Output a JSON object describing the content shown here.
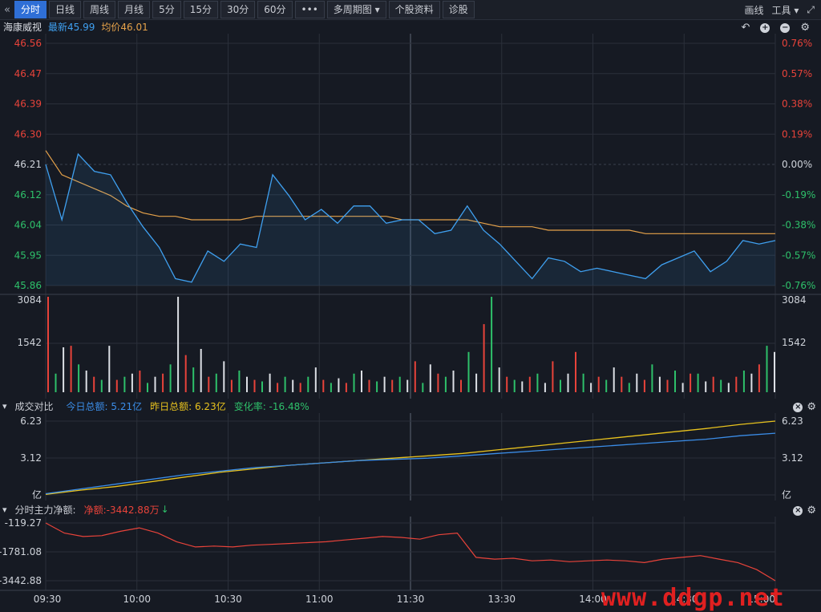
{
  "toolbar": {
    "back_icon": "double-chevron-left-icon",
    "tabs": [
      "分时",
      "日线",
      "周线",
      "月线",
      "5分",
      "15分",
      "30分",
      "60分",
      "•••",
      "多周期图",
      "个股资料",
      "诊股"
    ],
    "more_periods_arrow": "▾",
    "right": {
      "draw_label": "画线",
      "tools_label": "工具",
      "expand_icon": "fullscreen-icon"
    }
  },
  "legend": {
    "stock_name": "海康威视",
    "latest_label": "最新45.99",
    "avg_label": "均价46.01"
  },
  "price_axis": {
    "left": [
      "46.56",
      "46.47",
      "46.39",
      "46.30",
      "46.21",
      "46.12",
      "46.04",
      "45.95",
      "45.86"
    ],
    "right": [
      "0.76%",
      "0.57%",
      "0.38%",
      "0.19%",
      "0.00%",
      "-0.19%",
      "-0.38%",
      "-0.57%",
      "-0.76%"
    ]
  },
  "volume_axis": {
    "left": [
      "3084",
      "1542"
    ],
    "right": [
      "3084",
      "1542"
    ]
  },
  "turnover": {
    "title": "成交对比",
    "today_label": "今日总额: 5.21亿",
    "yesterday_label": "昨日总额: 6.23亿",
    "change_label": "变化率: -16.48%",
    "axis_left": [
      "6.23",
      "3.12",
      "亿"
    ],
    "axis_right": [
      "6.23",
      "3.12",
      "亿"
    ]
  },
  "netflow": {
    "title": "分时主力净额:",
    "net_label": "净额:-3442.88万",
    "down_arrow": "↓",
    "axis_left": [
      "-119.27",
      "-1781.08",
      "-3442.88"
    ]
  },
  "time_axis": [
    "09:30",
    "10:00",
    "10:30",
    "11:00",
    "11:30",
    "13:30",
    "14:00",
    "14:30",
    "15:00"
  ],
  "watermark": "www.ddgp.net",
  "colors": {
    "up": "#e8433a",
    "down": "#2ec06a",
    "price_line": "#3fa0f0",
    "avg_line": "#e6a24a",
    "today_turnover": "#3b8de8",
    "yesterday_turnover": "#e8c21e",
    "netflow_line": "#e8433a"
  },
  "chart_data": [
    {
      "type": "line",
      "title": "",
      "ylim": [
        45.86,
        46.56
      ],
      "x": [
        "09:30",
        "10:00",
        "10:30",
        "11:00",
        "11:30",
        "13:30",
        "14:00",
        "14:30",
        "15:00"
      ],
      "series": [
        {
          "name": "最新",
          "values": [
            46.21,
            46.05,
            46.24,
            46.19,
            46.18,
            46.1,
            46.03,
            45.97,
            45.88,
            45.87,
            45.96,
            45.93,
            45.98,
            45.97,
            46.18,
            46.12,
            46.05,
            46.08,
            46.04,
            46.09,
            46.09,
            46.04,
            46.05,
            46.05,
            46.01,
            46.02,
            46.09,
            46.02,
            45.98,
            45.93,
            45.88,
            45.94,
            45.93,
            45.9,
            45.91,
            45.9,
            45.89,
            45.88,
            45.92,
            45.94,
            45.96,
            45.9,
            45.93,
            45.99,
            45.98,
            45.99
          ]
        },
        {
          "name": "均价",
          "values": [
            46.25,
            46.18,
            46.16,
            46.14,
            46.12,
            46.09,
            46.07,
            46.06,
            46.06,
            46.05,
            46.05,
            46.05,
            46.05,
            46.06,
            46.06,
            46.06,
            46.06,
            46.06,
            46.06,
            46.06,
            46.06,
            46.06,
            46.05,
            46.05,
            46.05,
            46.05,
            46.05,
            46.04,
            46.03,
            46.03,
            46.03,
            46.02,
            46.02,
            46.02,
            46.02,
            46.02,
            46.02,
            46.01,
            46.01,
            46.01,
            46.01,
            46.01,
            46.01,
            46.01,
            46.01,
            46.01
          ]
        }
      ]
    },
    {
      "type": "bar",
      "title": "",
      "ylim": [
        0,
        3084
      ],
      "values": [
        3084,
        600,
        1450,
        1500,
        900,
        700,
        500,
        400,
        1500,
        400,
        500,
        600,
        700,
        300,
        500,
        600,
        900,
        3084,
        1200,
        800,
        1400,
        500,
        600,
        1000,
        400,
        700,
        500,
        400,
        350,
        600,
        300,
        500,
        400,
        300,
        500,
        800,
        400,
        300,
        450,
        300,
        600,
        700,
        400,
        350,
        500,
        400,
        500,
        400,
        1000,
        300,
        900,
        600,
        500,
        700,
        400,
        1300,
        600,
        2200,
        3084,
        800,
        500,
        400,
        350,
        500,
        600,
        300,
        1000,
        400,
        600,
        1300,
        600,
        300,
        500,
        400,
        800,
        500,
        300,
        600,
        400,
        900,
        500,
        400,
        700,
        300,
        600,
        600,
        350,
        500,
        400,
        300,
        500,
        700,
        600,
        900,
        1500,
        1300
      ]
    },
    {
      "type": "line",
      "title": "",
      "ylim": [
        0,
        6.23
      ],
      "series": [
        {
          "name": "今日总额",
          "values": [
            0.1,
            0.5,
            0.9,
            1.3,
            1.7,
            2.0,
            2.3,
            2.5,
            2.7,
            2.9,
            3.0,
            3.1,
            3.3,
            3.5,
            3.7,
            3.9,
            4.1,
            4.3,
            4.5,
            4.7,
            5.0,
            5.21
          ]
        },
        {
          "name": "昨日总额",
          "values": [
            0.05,
            0.4,
            0.7,
            1.1,
            1.5,
            1.9,
            2.2,
            2.5,
            2.7,
            2.9,
            3.1,
            3.3,
            3.5,
            3.8,
            4.1,
            4.4,
            4.7,
            5.0,
            5.3,
            5.6,
            5.95,
            6.23
          ]
        }
      ]
    },
    {
      "type": "line",
      "title": "",
      "ylim": [
        -3442.88,
        -119.27
      ],
      "series": [
        {
          "name": "净额",
          "values": [
            -119.27,
            -700,
            -900,
            -850,
            -600,
            -400,
            -700,
            -1200,
            -1500,
            -1450,
            -1500,
            -1400,
            -1350,
            -1300,
            -1250,
            -1200,
            -1100,
            -1000,
            -900,
            -950,
            -1050,
            -800,
            -700,
            -2100,
            -2200,
            -2150,
            -2300,
            -2250,
            -2350,
            -2300,
            -2250,
            -2300,
            -2400,
            -2200,
            -2100,
            -2000,
            -2200,
            -2400,
            -2800,
            -3442.88
          ]
        }
      ]
    }
  ]
}
